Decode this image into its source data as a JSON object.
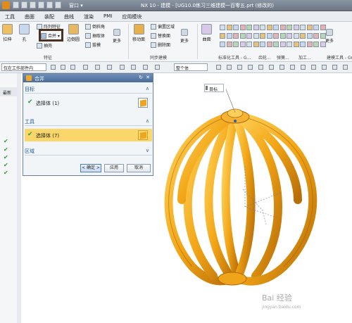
{
  "titlebar": {
    "window_menu": "窗口 ▾",
    "title": "NX 10 - 建模 - [UG10.0练习三维建模一百零五.prt  (修改的)"
  },
  "menu": [
    "工具",
    "曲面",
    "装配",
    "曲线",
    "渲染",
    "PMI",
    "应用模块"
  ],
  "ribbon": {
    "extrude": "拉伸",
    "hole": "孔",
    "array_feature": "阵列特征",
    "unite": "合并 ▾",
    "shell": "抽壳",
    "edge_blend": "边倒圆",
    "chamfer": "倒斜角",
    "draft": "拔模",
    "extract_body": "抽取体",
    "more": "更多",
    "offset_region": "偏置区域",
    "replace_face": "替换面",
    "delete_face": "删除面",
    "move_face": "移动面",
    "more2": "更多",
    "surface": "曲面",
    "more3": "更多",
    "group_feature": "特征",
    "group_sync": "同步建模",
    "group_standard": "标准化工具 - G...",
    "group_gear": "齿轮...",
    "group_spring": "弹簧...",
    "group_machining": "加工...",
    "group_build": "建模工具 - GC..."
  },
  "selection": {
    "filter": "仅在工作部件内",
    "scope": "整个体"
  },
  "left_panel": {
    "header": "最新",
    "check_count": 5
  },
  "dialog": {
    "title": "合并",
    "section_target": "目标",
    "target_select": "选择体 (1)",
    "section_tool": "工具",
    "tool_select": "选择体 (7)",
    "section_region": "区域",
    "ok": "< 确定 >",
    "apply": "应用",
    "cancel": "取消"
  },
  "viewport": {
    "target_label": "目标",
    "watermark": "Bai 经验",
    "watermark_sub": "jingyan.baidu.com"
  },
  "colors": {
    "model": "#f2a516",
    "model_shade": "#b76d08",
    "dialog_header": "#4a6d99",
    "highlight": "#fbd66b"
  }
}
